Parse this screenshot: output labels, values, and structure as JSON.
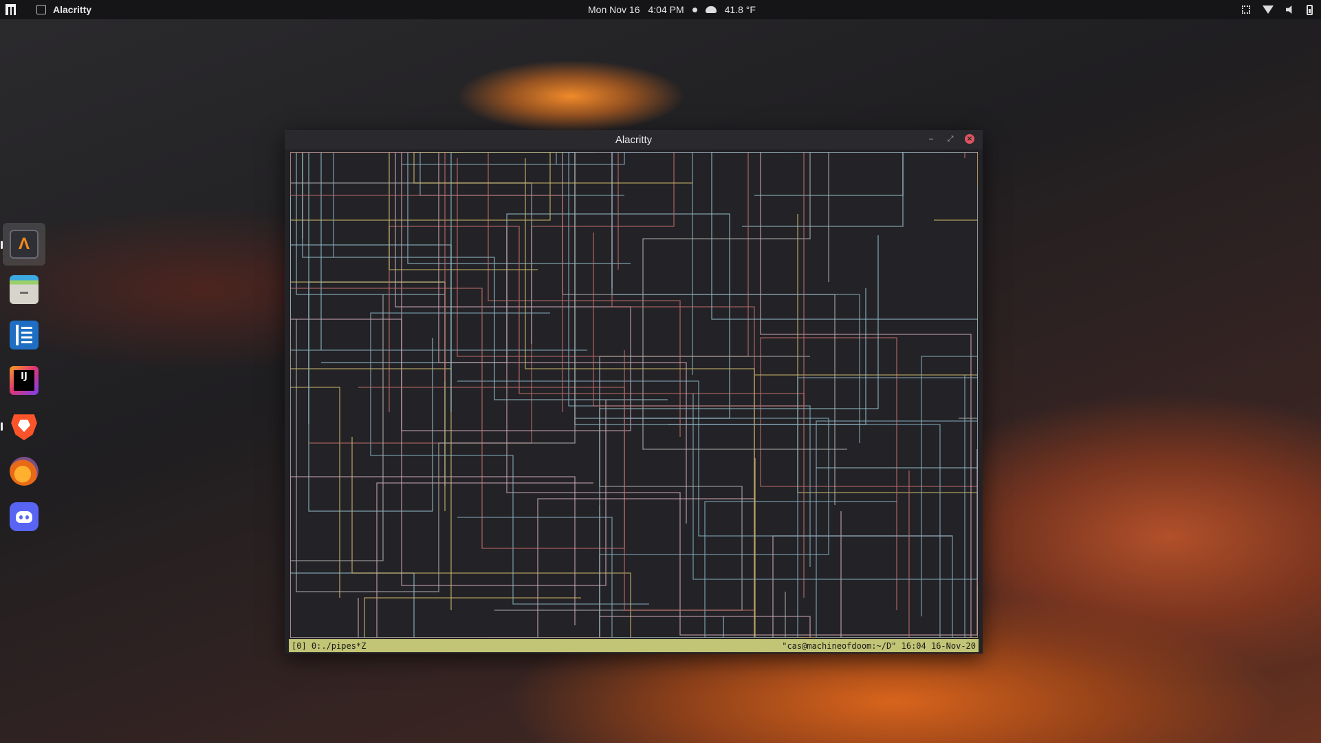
{
  "topbar": {
    "app_name": "Alacritty",
    "date": "Mon Nov 16",
    "time": "4:04 PM",
    "weather": "41.8 °F",
    "icons": [
      "workspaces-logo-icon",
      "window-app-icon",
      "weather-cloud-icon",
      "network-icon",
      "wifi-icon",
      "volume-icon",
      "battery-icon"
    ]
  },
  "dock": {
    "items": [
      {
        "name": "alacritty",
        "label": "Λ",
        "icon": "alacritty-icon",
        "active": true
      },
      {
        "name": "files",
        "label": "",
        "icon": "files-icon",
        "active": false
      },
      {
        "name": "notes",
        "label": "",
        "icon": "notes-icon",
        "active": false
      },
      {
        "name": "intellij",
        "label": "IJ",
        "icon": "intellij-icon",
        "active": false
      },
      {
        "name": "brave",
        "label": "",
        "icon": "brave-icon",
        "active": true
      },
      {
        "name": "firefox",
        "label": "",
        "icon": "firefox-icon",
        "active": false
      },
      {
        "name": "discord",
        "label": "",
        "icon": "discord-icon",
        "active": false
      }
    ]
  },
  "window": {
    "title": "Alacritty",
    "controls": {
      "minimize": "–",
      "maximize": "⤢",
      "close": "✕"
    }
  },
  "terminal": {
    "status_left": "[0] 0:./pipes*Z",
    "status_right": "\"cas@machineofdoom:~/D\" 16:04 16-Nov-20",
    "pipe_colors": [
      "#7fa8b8",
      "#c7b46a",
      "#b86a6a",
      "#a8a8a8",
      "#8fb7c4",
      "#c5a3b0"
    ]
  },
  "colors": {
    "statusbar": "#c2c476",
    "terminal_bg": "#232226",
    "titlebar": "#2a292d",
    "close_button": "#e05561"
  }
}
